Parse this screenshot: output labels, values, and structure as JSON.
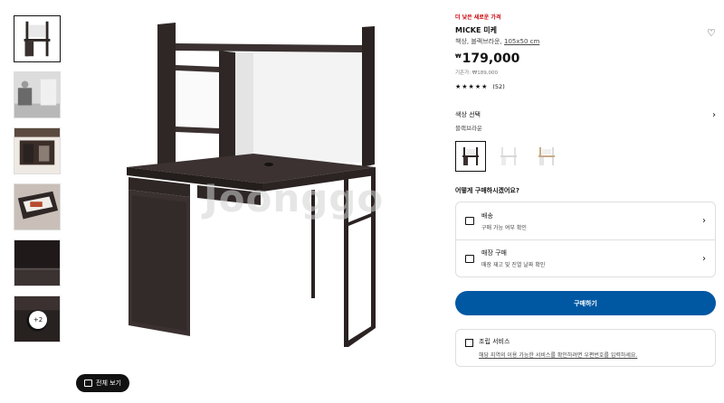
{
  "thumbnails": [
    {
      "name": "desk-front"
    },
    {
      "name": "room-scene"
    },
    {
      "name": "desk-side"
    },
    {
      "name": "drawer-detail"
    },
    {
      "name": "surface-detail"
    },
    {
      "name": "cable-detail",
      "more": "+2"
    }
  ],
  "fullview": {
    "label": "전체 보기"
  },
  "watermark": "Joonggo",
  "product": {
    "promo": "더 낮은 새로운 가격",
    "name": "MICKE 미케",
    "desc_prefix": "책상, 블랙브라운, ",
    "desc_size": "105x50 cm",
    "currency": "₩",
    "price": "179,000",
    "original_price": "기존가: ₩189,000",
    "stars": "★★★★★",
    "review_count": "(52)"
  },
  "color": {
    "label": "색상 선택",
    "value": "블랙브라운",
    "swatches": [
      "블랙브라운",
      "화이트",
      "화이트/오크"
    ]
  },
  "purchase": {
    "question": "어떻게 구매하시겠어요?",
    "options": [
      {
        "title": "배송",
        "subtitle": "구매 가능 여부 확인"
      },
      {
        "title": "매장 구매",
        "subtitle": "매장 재고 및 진열 날짜 확인"
      }
    ],
    "buy_label": "구매하기"
  },
  "assembly": {
    "title": "조립 서비스",
    "text": "해당 지역의 이용 가능한 서비스를 확인하려면 우편번호를 입력하세요."
  },
  "colors": {
    "accent": "#0058a3",
    "promo": "#cc0008",
    "desk": "#2e2726"
  }
}
